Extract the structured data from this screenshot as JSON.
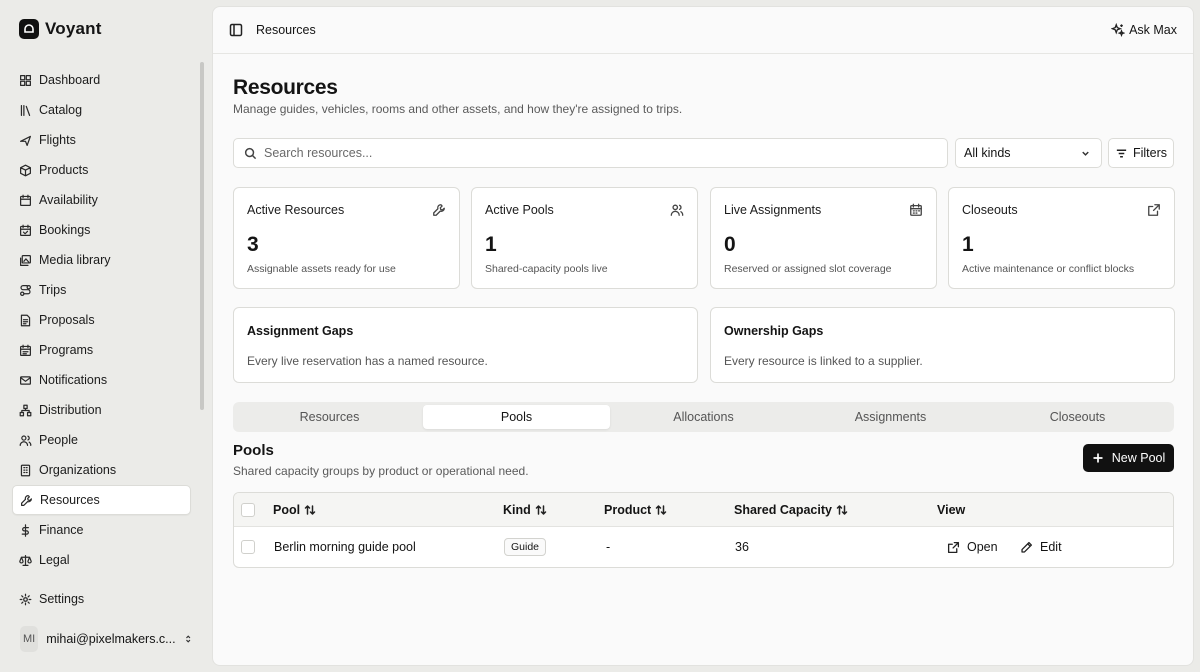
{
  "app": {
    "name": "Voyant"
  },
  "sidebar": {
    "items": [
      {
        "label": "Dashboard",
        "icon": "dashboard-icon"
      },
      {
        "label": "Catalog",
        "icon": "library-icon"
      },
      {
        "label": "Flights",
        "icon": "plane-icon"
      },
      {
        "label": "Products",
        "icon": "package-icon"
      },
      {
        "label": "Availability",
        "icon": "calendar-icon"
      },
      {
        "label": "Bookings",
        "icon": "calendar-check-icon"
      },
      {
        "label": "Media library",
        "icon": "images-icon"
      },
      {
        "label": "Trips",
        "icon": "route-icon"
      },
      {
        "label": "Proposals",
        "icon": "file-text-icon"
      },
      {
        "label": "Programs",
        "icon": "calendar-range-icon"
      },
      {
        "label": "Notifications",
        "icon": "mail-icon"
      },
      {
        "label": "Distribution",
        "icon": "network-icon"
      },
      {
        "label": "People",
        "icon": "users-icon"
      },
      {
        "label": "Organizations",
        "icon": "building-icon"
      },
      {
        "label": "Resources",
        "icon": "wrench-icon",
        "active": true
      },
      {
        "label": "Finance",
        "icon": "dollar-icon"
      },
      {
        "label": "Legal",
        "icon": "scale-icon"
      }
    ],
    "settings": "Settings",
    "user": {
      "initials": "MI",
      "email": "mihai@pixelmakers.c..."
    }
  },
  "topbar": {
    "breadcrumb": "Resources",
    "ask": "Ask Max"
  },
  "page": {
    "title": "Resources",
    "subtitle": "Manage guides, vehicles, rooms and other assets, and how they're assigned to trips."
  },
  "search": {
    "placeholder": "Search resources..."
  },
  "kind_filter": {
    "value": "All kinds"
  },
  "filters_label": "Filters",
  "stats": [
    {
      "label": "Active Resources",
      "value": "3",
      "desc": "Assignable assets ready for use",
      "icon": "wrench-icon"
    },
    {
      "label": "Active Pools",
      "value": "1",
      "desc": "Shared-capacity pools live",
      "icon": "users-icon"
    },
    {
      "label": "Live Assignments",
      "value": "0",
      "desc": "Reserved or assigned slot coverage",
      "icon": "calendar-icon"
    },
    {
      "label": "Closeouts",
      "value": "1",
      "desc": "Active maintenance or conflict blocks",
      "icon": "external-link-icon"
    }
  ],
  "gaps": [
    {
      "title": "Assignment Gaps",
      "text": "Every live reservation has a named resource."
    },
    {
      "title": "Ownership Gaps",
      "text": "Every resource is linked to a supplier."
    }
  ],
  "tabs": [
    {
      "label": "Resources"
    },
    {
      "label": "Pools",
      "active": true
    },
    {
      "label": "Allocations"
    },
    {
      "label": "Assignments"
    },
    {
      "label": "Closeouts"
    }
  ],
  "section": {
    "title": "Pools",
    "subtitle": "Shared capacity groups by product or operational need.",
    "new_button": "New Pool"
  },
  "table": {
    "columns": [
      "Pool",
      "Kind",
      "Product",
      "Shared Capacity",
      "View"
    ],
    "rows": [
      {
        "pool": "Berlin morning guide pool",
        "kind": "Guide",
        "product": "-",
        "capacity": "36",
        "open": "Open",
        "edit": "Edit"
      }
    ]
  }
}
